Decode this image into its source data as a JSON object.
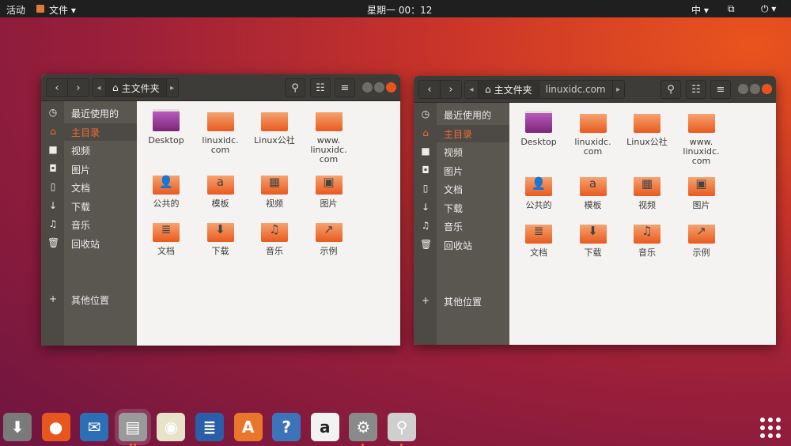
{
  "topbar": {
    "activities": "活动",
    "app_menu": "文件 ▾",
    "clock": "星期一 00：12",
    "input_method": "中 ▾",
    "network": "⧉",
    "power": "⏻ ▾"
  },
  "windows": [
    {
      "crumbs": [
        "主文件夹"
      ],
      "active_crumb": 0
    },
    {
      "crumbs": [
        "主文件夹",
        "linuxidc.com"
      ],
      "active_crumb": 0
    }
  ],
  "sidebar": [
    {
      "icon": "clock-icon",
      "glyph": "◷",
      "label": "最近使用的"
    },
    {
      "icon": "home-icon",
      "glyph": "⌂",
      "label": "主目录",
      "active": true
    },
    {
      "icon": "video-icon",
      "glyph": "■",
      "label": "视频"
    },
    {
      "icon": "camera-icon",
      "glyph": "◘",
      "label": "图片"
    },
    {
      "icon": "document-icon",
      "glyph": "▯",
      "label": "文档"
    },
    {
      "icon": "download-icon",
      "glyph": "↓",
      "label": "下载"
    },
    {
      "icon": "music-icon",
      "glyph": "♫",
      "label": "音乐"
    },
    {
      "icon": "trash-icon",
      "glyph": "🗑",
      "label": "回收站"
    },
    {
      "icon": "plus-icon",
      "glyph": "+",
      "label": "其他位置"
    }
  ],
  "files": [
    {
      "label": "Desktop",
      "type": "desktop",
      "emblem": ""
    },
    {
      "label": "linuxidc.\ncom",
      "type": "folder",
      "emblem": ""
    },
    {
      "label": "Linux公社",
      "type": "folder",
      "emblem": ""
    },
    {
      "label": "www.\nlinuxidc.\ncom",
      "type": "folder",
      "emblem": ""
    },
    {
      "label": "公共的",
      "type": "folder",
      "emblem": "👤"
    },
    {
      "label": "模板",
      "type": "folder",
      "emblem": "a"
    },
    {
      "label": "视频",
      "type": "folder",
      "emblem": "▦"
    },
    {
      "label": "图片",
      "type": "folder",
      "emblem": "▣"
    },
    {
      "label": "文档",
      "type": "folder",
      "emblem": "≣"
    },
    {
      "label": "下载",
      "type": "folder",
      "emblem": "⬇"
    },
    {
      "label": "音乐",
      "type": "folder",
      "emblem": "♫"
    },
    {
      "label": "示例",
      "type": "folder",
      "emblem": "↗"
    }
  ],
  "dock": [
    {
      "name": "ubuntu-installer",
      "glyph": "⬇",
      "color": "#7a7a7a"
    },
    {
      "name": "firefox",
      "glyph": "●",
      "color": "#e8561f"
    },
    {
      "name": "thunderbird",
      "glyph": "✉",
      "color": "#2d6fb5"
    },
    {
      "name": "files",
      "glyph": "▤",
      "color": "#9a9a9a",
      "running": 2
    },
    {
      "name": "rhythmbox",
      "glyph": "◉",
      "color": "#e8e2c8"
    },
    {
      "name": "libreoffice-writer",
      "glyph": "≣",
      "color": "#2a5ea8"
    },
    {
      "name": "ubuntu-software",
      "glyph": "A",
      "color": "#e9762b"
    },
    {
      "name": "help",
      "glyph": "?",
      "color": "#3d73b8"
    },
    {
      "name": "amazon",
      "glyph": "a",
      "color": "#f2f2f2"
    },
    {
      "name": "system-settings",
      "glyph": "⚙",
      "color": "#8a8a8a",
      "running": 1
    },
    {
      "name": "software-updater",
      "glyph": "⚲",
      "color": "#cfcfcf",
      "running": 1
    }
  ],
  "colors": {
    "accent": "#f06b35",
    "header": "#3e3c38",
    "sidebar": "#5a5751"
  }
}
